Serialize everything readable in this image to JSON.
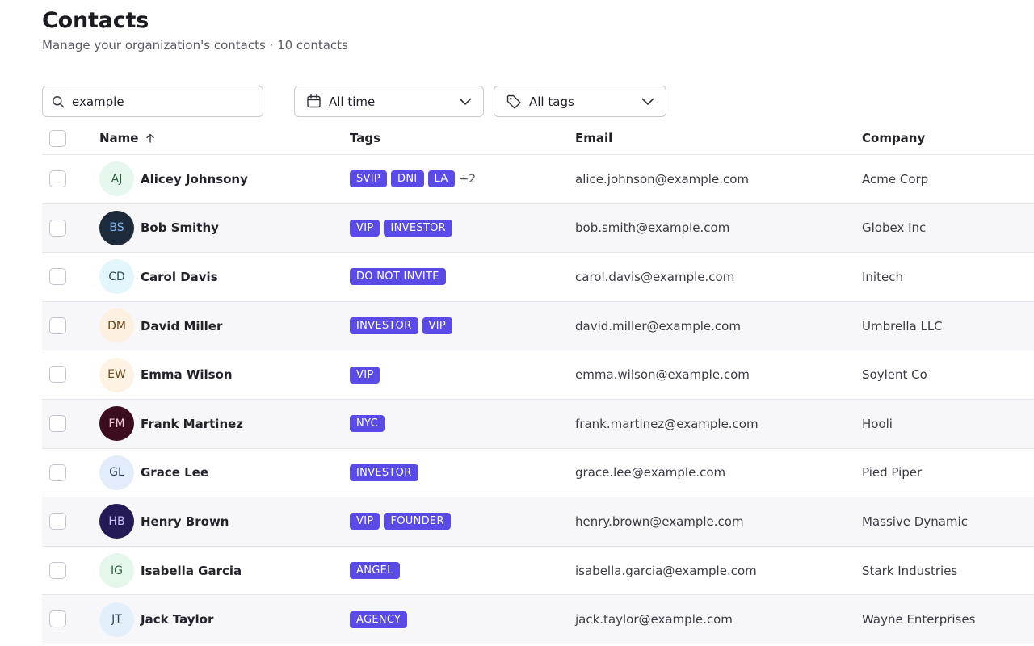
{
  "header": {
    "title": "Contacts",
    "subtitle": "Manage your organization's contacts · 10 contacts"
  },
  "filters": {
    "search_value": "example",
    "time_label": "All time",
    "tags_label": "All tags"
  },
  "table": {
    "columns": [
      "Name",
      "Tags",
      "Email",
      "Company"
    ],
    "sort_indicator": "ascending",
    "rows": [
      {
        "initials": "AJ",
        "name": "Alicey Johnsony",
        "tags": [
          "SVIP",
          "DNI",
          "LA"
        ],
        "more_tags": "+2",
        "email": "alice.johnson@example.com",
        "company": "Acme Corp",
        "avatar_bg": "#e6f8ee",
        "avatar_fg": "#2b5b3a"
      },
      {
        "initials": "BS",
        "name": "Bob Smithy",
        "tags": [
          "VIP",
          "INVESTOR"
        ],
        "more_tags": "",
        "email": "bob.smith@example.com",
        "company": "Globex Inc",
        "avatar_bg": "#1d2a3b",
        "avatar_fg": "#7fb4ef"
      },
      {
        "initials": "CD",
        "name": "Carol Davis",
        "tags": [
          "DO NOT INVITE"
        ],
        "more_tags": "",
        "email": "carol.davis@example.com",
        "company": "Initech",
        "avatar_bg": "#e2f6fb",
        "avatar_fg": "#2a4650"
      },
      {
        "initials": "DM",
        "name": "David Miller",
        "tags": [
          "INVESTOR",
          "VIP"
        ],
        "more_tags": "",
        "email": "david.miller@example.com",
        "company": "Umbrella LLC",
        "avatar_bg": "#fdf0e0",
        "avatar_fg": "#6b4418"
      },
      {
        "initials": "EW",
        "name": "Emma Wilson",
        "tags": [
          "VIP"
        ],
        "more_tags": "",
        "email": "emma.wilson@example.com",
        "company": "Soylent Co",
        "avatar_bg": "#fdf2e3",
        "avatar_fg": "#6e5020"
      },
      {
        "initials": "FM",
        "name": "Frank Martinez",
        "tags": [
          "NYC"
        ],
        "more_tags": "",
        "email": "frank.martinez@example.com",
        "company": "Hooli",
        "avatar_bg": "#3b0d1f",
        "avatar_fg": "#f1c5d6"
      },
      {
        "initials": "GL",
        "name": "Grace Lee",
        "tags": [
          "INVESTOR"
        ],
        "more_tags": "",
        "email": "grace.lee@example.com",
        "company": "Pied Piper",
        "avatar_bg": "#e3ecfb",
        "avatar_fg": "#2e3e5c"
      },
      {
        "initials": "HB",
        "name": "Henry Brown",
        "tags": [
          "VIP",
          "FOUNDER"
        ],
        "more_tags": "",
        "email": "henry.brown@example.com",
        "company": "Massive Dynamic",
        "avatar_bg": "#241a55",
        "avatar_fg": "#c9c0ff"
      },
      {
        "initials": "IG",
        "name": "Isabella Garcia",
        "tags": [
          "ANGEL"
        ],
        "more_tags": "",
        "email": "isabella.garcia@example.com",
        "company": "Stark Industries",
        "avatar_bg": "#e4f7ea",
        "avatar_fg": "#2d5d3c"
      },
      {
        "initials": "JT",
        "name": "Jack Taylor",
        "tags": [
          "AGENCY"
        ],
        "more_tags": "",
        "email": "jack.taylor@example.com",
        "company": "Wayne Enterprises",
        "avatar_bg": "#e3f0fb",
        "avatar_fg": "#2b4560"
      }
    ]
  },
  "colors": {
    "tag": "#5b4be6",
    "border": "#e4e4ea",
    "row_alt": "#f7f7f9"
  },
  "icons": {
    "search": "search-icon",
    "calendar": "calendar-icon",
    "tag": "tag-icon",
    "chevron": "chevron-down-icon",
    "sort": "arrow-up-icon"
  }
}
